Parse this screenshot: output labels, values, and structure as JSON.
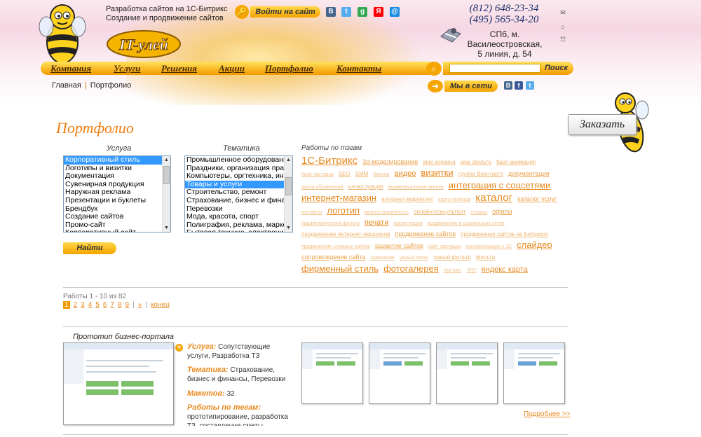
{
  "header": {
    "tagline_line1": "Разработка сайтов на 1С-Битрикс",
    "tagline_line2": "Создание и продвижение сайтов",
    "logo_text": "IT-улей",
    "enter_button": "Войти на сайт",
    "social_top": [
      {
        "name": "vk",
        "glyph": "В",
        "color": "#45668e"
      },
      {
        "name": "twitter",
        "glyph": "t",
        "color": "#55acee"
      },
      {
        "name": "google",
        "glyph": "g",
        "color": "#34a853"
      },
      {
        "name": "yandex",
        "glyph": "Я",
        "color": "#ff0000"
      },
      {
        "name": "mail",
        "glyph": "@",
        "color": "#168de2"
      }
    ],
    "phone1": "(812) 648-23-34",
    "phone2": "(495) 565-34-20",
    "address_line1": "СПб, м.",
    "address_line2": "Василеостровская,",
    "address_line3": "5 линия, д. 54",
    "right_icons": [
      {
        "name": "mail-icon",
        "glyph": "✉"
      },
      {
        "name": "home-icon",
        "glyph": "⌂"
      },
      {
        "name": "sitemap-icon",
        "glyph": "☷"
      }
    ]
  },
  "nav": {
    "items": [
      "Компания",
      "Услуги",
      "Решения",
      "Акции",
      "Портфолио",
      "Контакты"
    ]
  },
  "search": {
    "placeholder": "",
    "button": "Поиск"
  },
  "breadcrumb": {
    "home": "Главная",
    "current": "Портфолио"
  },
  "social_net": {
    "label": "Мы в сети",
    "icons": [
      {
        "name": "vk",
        "glyph": "В",
        "color": "#45668e"
      },
      {
        "name": "facebook",
        "glyph": "f",
        "color": "#3b5998"
      },
      {
        "name": "twitter",
        "glyph": "t",
        "color": "#55acee"
      }
    ]
  },
  "order_button": "Заказать",
  "page_title": "Портфолио",
  "filters": {
    "service_label": "Услуга",
    "theme_label": "Тематика",
    "service_options": [
      "Корпоративный стиль",
      "Логотипы и визитки",
      "Документация",
      "Сувенирная продукция",
      "Наружная реклама",
      "Презентации и буклеты",
      "Брендбук",
      "Создание сайтов",
      "Промо-сайт",
      "Корпоративный сайт"
    ],
    "service_selected": 0,
    "theme_options": [
      "Промышленное оборудование",
      "Праздники, организация праздников",
      "Компьютеры, оргтехника, интернет",
      "Товары и услуги",
      "Строительство, ремонт",
      "Страхование, бизнес и финансы",
      "Перевозки",
      "Мода, красота, спорт",
      "Полиграфия, реклама, маркетинг",
      "Бытовая техника, электроника"
    ],
    "theme_selected": 3,
    "find_button": "Найти"
  },
  "tags": {
    "title": "Работы по тэгам",
    "items": [
      {
        "text": "1С-Битрикс",
        "w": 6
      },
      {
        "text": "3d-моделирование",
        "w": 3
      },
      {
        "text": "ajax корзина",
        "w": 2
      },
      {
        "text": "ajax фильтр",
        "w": 2
      },
      {
        "text": "flash-анимация",
        "w": 2
      },
      {
        "text": "flash-заставка",
        "w": 1
      },
      {
        "text": "SEO",
        "w": 2
      },
      {
        "text": "SMM",
        "w": 2
      },
      {
        "text": "баннер",
        "w": 1
      },
      {
        "text": "видео",
        "w": 4
      },
      {
        "text": "визитки",
        "w": 5
      },
      {
        "text": "группа Вконтакте",
        "w": 2
      },
      {
        "text": "документация",
        "w": 3
      },
      {
        "text": "доска объявлений",
        "w": 1
      },
      {
        "text": "иллюстрация",
        "w": 2
      },
      {
        "text": "индивидуальные иконки",
        "w": 1
      },
      {
        "text": "интеграция с соцсетями",
        "w": 5
      },
      {
        "text": "интернет-магазин",
        "w": 5
      },
      {
        "text": "интернет-маркетинг",
        "w": 2
      },
      {
        "text": "карта проезда",
        "w": 1
      },
      {
        "text": "каталог",
        "w": 6
      },
      {
        "text": "каталог услуг",
        "w": 3
      },
      {
        "text": "контакты",
        "w": 1
      },
      {
        "text": "логотип",
        "w": 5
      },
      {
        "text": "многостраничность",
        "w": 1
      },
      {
        "text": "онлайн-консультант",
        "w": 2
      },
      {
        "text": "отзывы",
        "w": 1
      },
      {
        "text": "офисы",
        "w": 3
      },
      {
        "text": "параметрический фильтр",
        "w": 1
      },
      {
        "text": "печати",
        "w": 4
      },
      {
        "text": "презентация",
        "w": 1
      },
      {
        "text": "продвижение в социальных сетях",
        "w": 1
      },
      {
        "text": "продвижение интернет-магазинов",
        "w": 2
      },
      {
        "text": "продвижение сайтов",
        "w": 3
      },
      {
        "text": "продвижение сайтов на Битриксе",
        "w": 2
      },
      {
        "text": "продвижение сложных сайтов",
        "w": 1
      },
      {
        "text": "развитие сайтов",
        "w": 3
      },
      {
        "text": "сайт-заглушка",
        "w": 1
      },
      {
        "text": "синхронизация с 1С",
        "w": 1
      },
      {
        "text": "слайдер",
        "w": 5
      },
      {
        "text": "сопровождение сайта",
        "w": 3
      },
      {
        "text": "сравнение",
        "w": 1
      },
      {
        "text": "умный поиск",
        "w": 1
      },
      {
        "text": "умный фильтр",
        "w": 2
      },
      {
        "text": "фильтр",
        "w": 2
      },
      {
        "text": "фирменный стиль",
        "w": 5
      },
      {
        "text": "фотогалерея",
        "w": 5
      },
      {
        "text": "Хостинг",
        "w": 1
      },
      {
        "text": "ЧПУ",
        "w": 1
      },
      {
        "text": "яндекс карта",
        "w": 4
      }
    ]
  },
  "pagination": {
    "info": "Работы 1 - 10 из 82",
    "pages": [
      "1",
      "2",
      "3",
      "4",
      "5",
      "6",
      "7",
      "8",
      "9"
    ],
    "current": 0,
    "next": "»",
    "last": "конец"
  },
  "item": {
    "title": "Прототип бизнес-портала",
    "service_key": "Услуга:",
    "service_val": "Сопутствующие услуги, Разработка ТЗ",
    "theme_key": "Тематика:",
    "theme_val": "Страхование, бизнес и финансы, Перевозки",
    "layouts_key": "Макетов:",
    "layouts_val": "32",
    "tags_key": "Работы по тегам:",
    "tags_val": "прототипирование, разработка ТЗ, составление сметы",
    "more": "Подробнее >>"
  },
  "colors": {
    "accent": "#f07e12",
    "link": "#e88a20",
    "nav_top": "#ffe15a",
    "nav_bottom": "#f39a00",
    "phone": "#1a2f6a"
  }
}
